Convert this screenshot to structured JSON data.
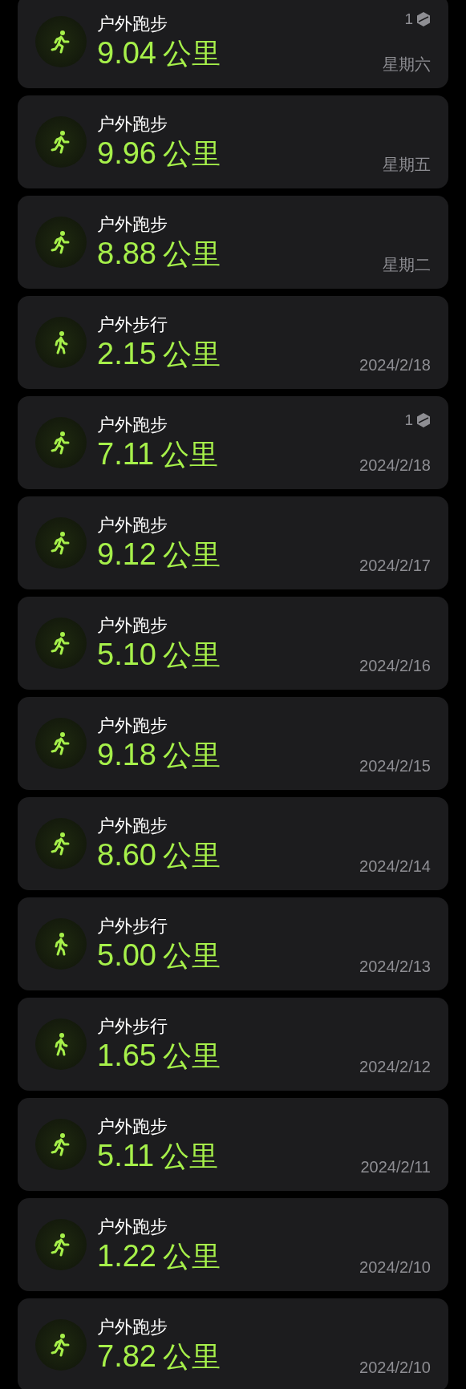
{
  "workouts": [
    {
      "kind": "run",
      "title": "户外跑步",
      "distance": "9.04",
      "unit": "公里",
      "badge": "1",
      "date": "星期六"
    },
    {
      "kind": "run",
      "title": "户外跑步",
      "distance": "9.96",
      "unit": "公里",
      "date": "星期五"
    },
    {
      "kind": "run",
      "title": "户外跑步",
      "distance": "8.88",
      "unit": "公里",
      "date": "星期二"
    },
    {
      "kind": "walk",
      "title": "户外步行",
      "distance": "2.15",
      "unit": "公里",
      "date": "2024/2/18"
    },
    {
      "kind": "run",
      "title": "户外跑步",
      "distance": "7.11",
      "unit": "公里",
      "badge": "1",
      "date": "2024/2/18"
    },
    {
      "kind": "run",
      "title": "户外跑步",
      "distance": "9.12",
      "unit": "公里",
      "date": "2024/2/17"
    },
    {
      "kind": "run",
      "title": "户外跑步",
      "distance": "5.10",
      "unit": "公里",
      "date": "2024/2/16"
    },
    {
      "kind": "run",
      "title": "户外跑步",
      "distance": "9.18",
      "unit": "公里",
      "date": "2024/2/15"
    },
    {
      "kind": "run",
      "title": "户外跑步",
      "distance": "8.60",
      "unit": "公里",
      "date": "2024/2/14"
    },
    {
      "kind": "walk",
      "title": "户外步行",
      "distance": "5.00",
      "unit": "公里",
      "date": "2024/2/13"
    },
    {
      "kind": "walk",
      "title": "户外步行",
      "distance": "1.65",
      "unit": "公里",
      "date": "2024/2/12"
    },
    {
      "kind": "run",
      "title": "户外跑步",
      "distance": "5.11",
      "unit": "公里",
      "date": "2024/2/11"
    },
    {
      "kind": "run",
      "title": "户外跑步",
      "distance": "1.22",
      "unit": "公里",
      "date": "2024/2/10"
    },
    {
      "kind": "run",
      "title": "户外跑步",
      "distance": "7.82",
      "unit": "公里",
      "date": "2024/2/10"
    }
  ]
}
